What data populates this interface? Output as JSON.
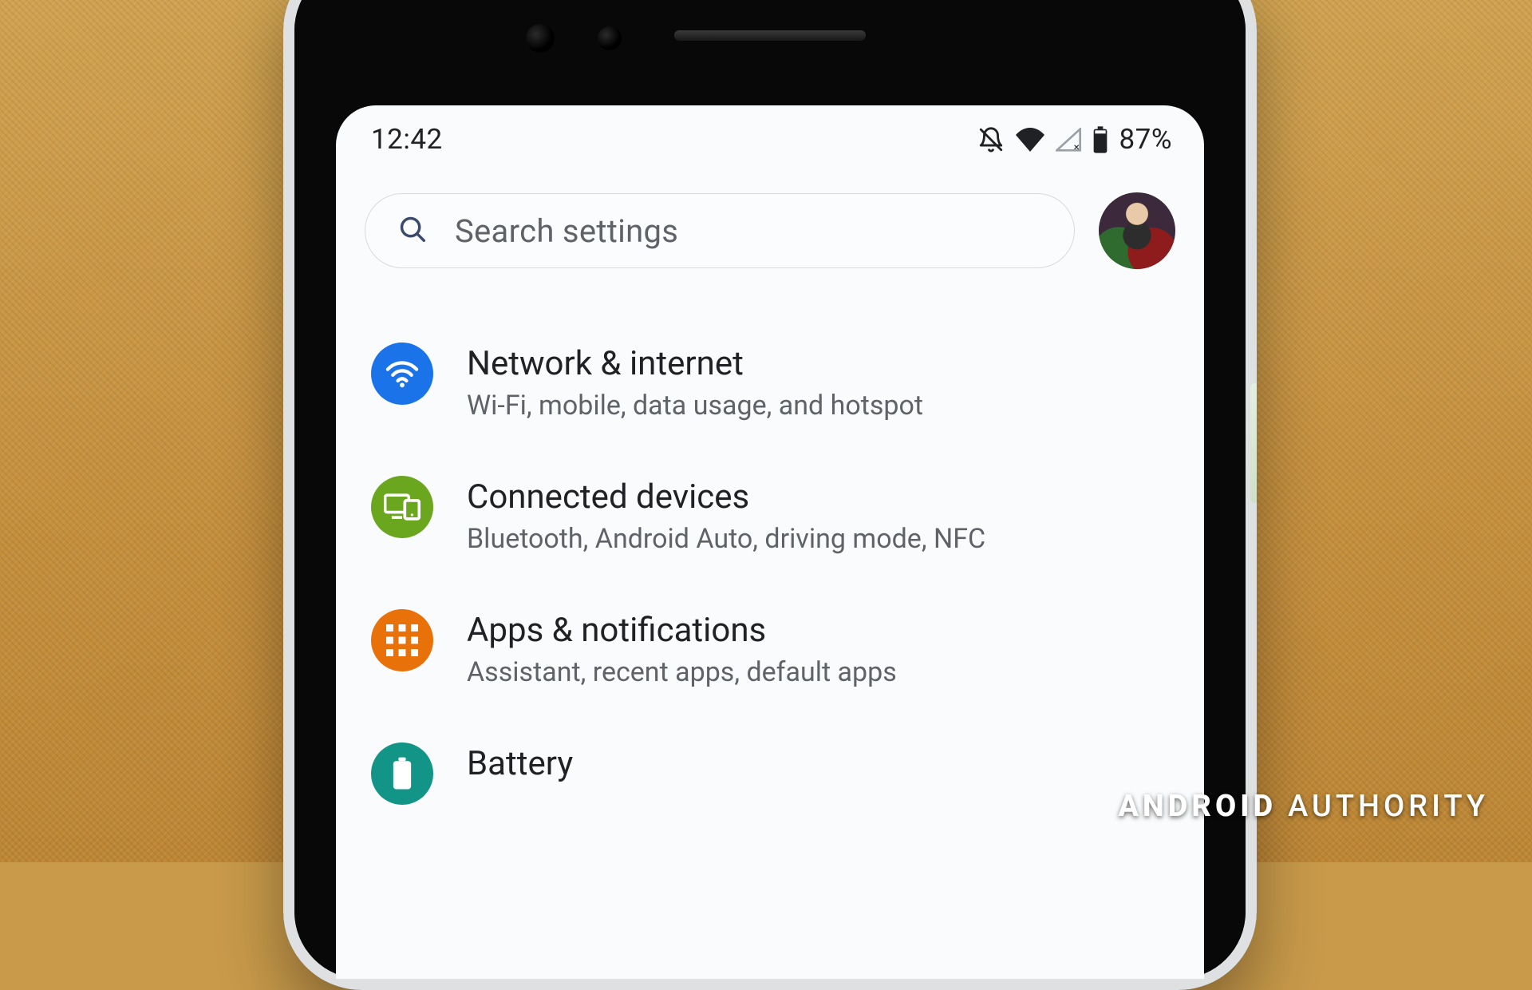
{
  "statusbar": {
    "time": "12:42",
    "battery_text": "87%",
    "icons": {
      "dnd": "bell-off-icon",
      "wifi": "wifi-icon",
      "cell": "cell-no-signal-icon",
      "battery": "battery-icon"
    }
  },
  "search": {
    "placeholder": "Search settings",
    "icon": "search-icon"
  },
  "avatar": "user-avatar",
  "settings": [
    {
      "key": "network",
      "title": "Network & internet",
      "subtitle": "Wi-Fi, mobile, data usage, and hotspot",
      "icon": "wifi-icon",
      "color": "blue"
    },
    {
      "key": "connected",
      "title": "Connected devices",
      "subtitle": "Bluetooth, Android Auto, driving mode, NFC",
      "icon": "devices-icon",
      "color": "green"
    },
    {
      "key": "apps",
      "title": "Apps & notifications",
      "subtitle": "Assistant, recent apps, default apps",
      "icon": "apps-grid-icon",
      "color": "orange"
    },
    {
      "key": "battery",
      "title": "Battery",
      "subtitle": "",
      "icon": "battery-icon",
      "color": "teal"
    }
  ],
  "watermark": {
    "brand_bold": "ANDROID",
    "brand_light": "AUTHORITY"
  }
}
